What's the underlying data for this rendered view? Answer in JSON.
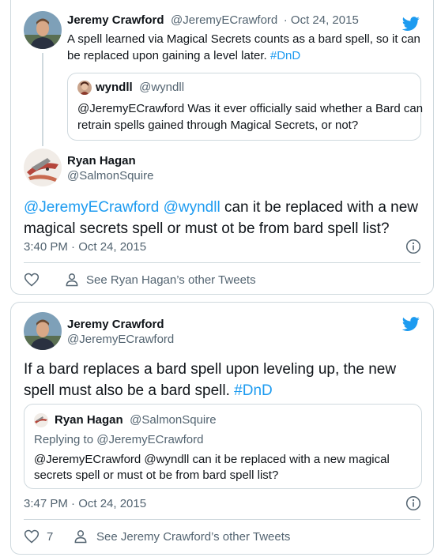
{
  "tweet1": {
    "author_name": "Jeremy Crawford",
    "author_handle": "@JeremyECrawford",
    "date": "· Oct 24, 2015",
    "text_line1": "A spell learned via Magical Secrets counts as a bard spell, so it can",
    "text_line2": "be replaced upon gaining a level later.",
    "hashtag": "#DnD",
    "quote": {
      "author_name": "wyndll",
      "author_handle": "@wyndll",
      "text_line1": "@JeremyECrawford Was it ever officially said whether a Bard can",
      "text_line2": "retrain spells gained through Magical Secrets, or not?"
    }
  },
  "reply": {
    "author_name": "Ryan Hagan",
    "author_handle": "@SalmonSquire",
    "mention1": "@JeremyECrawford",
    "mention2": "@wyndll",
    "text_line1_rest": "can it be replaced with a new",
    "text_line2": "magical secrets spell or must ot be from bard spell list?",
    "timestamp": "3:40 PM · Oct 24, 2015",
    "see_more": "See Ryan Hagan’s other Tweets"
  },
  "tweet2": {
    "author_name": "Jeremy Crawford",
    "author_handle": "@JeremyECrawford",
    "text_line1": "If a bard replaces a bard spell upon leveling up, the new",
    "text_line2": "spell must also be a bard spell.",
    "hashtag": "#DnD",
    "quote": {
      "author_name": "Ryan Hagan",
      "author_handle": "@SalmonSquire",
      "replying_to_label": "Replying to",
      "replying_to_handle": "@JeremyECrawford",
      "text_line1": "@JeremyECrawford @wyndll can it be replaced with a new magical",
      "text_line2": "secrets spell or must ot be from bard spell list?"
    },
    "timestamp": "3:47 PM · Oct 24, 2015",
    "like_count": "7",
    "see_more": "See Jeremy Crawford’s other Tweets"
  },
  "colors": {
    "twitter_blue": "#1d9bf0",
    "text": "#0f1419",
    "muted": "#536471",
    "border": "#cfd9de"
  },
  "icons": [
    "twitter-bird-icon",
    "info-icon",
    "heart-icon",
    "person-icon"
  ]
}
